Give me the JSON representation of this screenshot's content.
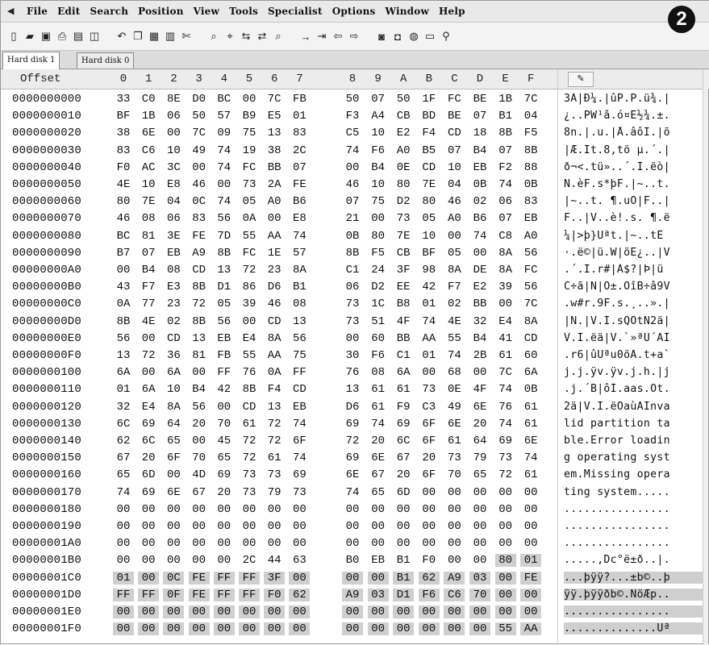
{
  "menu": {
    "items": [
      "File",
      "Edit",
      "Search",
      "Position",
      "View",
      "Tools",
      "Specialist",
      "Options",
      "Window",
      "Help"
    ],
    "app_icon": "back-arrow-icon"
  },
  "badge": {
    "label": "2"
  },
  "toolbar": {
    "buttons": [
      "new-file-icon",
      "open-folder-icon",
      "save-icon",
      "print-icon",
      "properties-icon",
      "open-disk-icon",
      "undo-icon",
      "copy-icon",
      "paste-block-icon",
      "paste-icon",
      "clipboard-icon",
      "find-icon",
      "find-hex-icon",
      "replace-icon",
      "replace-hex-icon",
      "find-next-icon",
      "goto-offset-icon",
      "goto-sector-icon",
      "back-icon",
      "forward-icon",
      "disk-icon",
      "disk-copy-icon",
      "disk-view-icon",
      "memory-icon",
      "zoom-icon"
    ]
  },
  "tabs": [
    {
      "label": "Hard disk 1",
      "active": true
    },
    {
      "label": "Hard disk 0",
      "active": false
    }
  ],
  "header": {
    "offset_label": "Offset",
    "columns": [
      "0",
      "1",
      "2",
      "3",
      "4",
      "5",
      "6",
      "7",
      "8",
      "9",
      "A",
      "B",
      "C",
      "D",
      "E",
      "F"
    ],
    "ascii_tool_icon": "pencil-icon"
  },
  "rows": [
    {
      "offset": "0000000000",
      "bytes": [
        "33",
        "C0",
        "8E",
        "D0",
        "BC",
        "00",
        "7C",
        "FB",
        "50",
        "07",
        "50",
        "1F",
        "FC",
        "BE",
        "1B",
        "7C"
      ],
      "ascii": "3À|Ð¼.|ûP.P.ü¾.|"
    },
    {
      "offset": "0000000010",
      "bytes": [
        "BF",
        "1B",
        "06",
        "50",
        "57",
        "B9",
        "E5",
        "01",
        "F3",
        "A4",
        "CB",
        "BD",
        "BE",
        "07",
        "B1",
        "04"
      ],
      "ascii": "¿..PW¹å.ó¤Ë½¾.±."
    },
    {
      "offset": "0000000020",
      "bytes": [
        "38",
        "6E",
        "00",
        "7C",
        "09",
        "75",
        "13",
        "83",
        "C5",
        "10",
        "E2",
        "F4",
        "CD",
        "18",
        "8B",
        "F5"
      ],
      "ascii": "8n.|.u.|Å.âôÍ.|õ"
    },
    {
      "offset": "0000000030",
      "bytes": [
        "83",
        "C6",
        "10",
        "49",
        "74",
        "19",
        "38",
        "2C",
        "74",
        "F6",
        "A0",
        "B5",
        "07",
        "B4",
        "07",
        "8B"
      ],
      "ascii": "|Æ.It.8,tö µ.´.|"
    },
    {
      "offset": "0000000040",
      "bytes": [
        "F0",
        "AC",
        "3C",
        "00",
        "74",
        "FC",
        "BB",
        "07",
        "00",
        "B4",
        "0E",
        "CD",
        "10",
        "EB",
        "F2",
        "88"
      ],
      "ascii": "ð¬<.tü»..´.Í.ëò|"
    },
    {
      "offset": "0000000050",
      "bytes": [
        "4E",
        "10",
        "E8",
        "46",
        "00",
        "73",
        "2A",
        "FE",
        "46",
        "10",
        "80",
        "7E",
        "04",
        "0B",
        "74",
        "0B"
      ],
      "ascii": "N.èF.s*þF.|~..t."
    },
    {
      "offset": "0000000060",
      "bytes": [
        "80",
        "7E",
        "04",
        "0C",
        "74",
        "05",
        "A0",
        "B6",
        "07",
        "75",
        "D2",
        "80",
        "46",
        "02",
        "06",
        "83"
      ],
      "ascii": "|~..t. ¶.uÒ|F..|"
    },
    {
      "offset": "0000000070",
      "bytes": [
        "46",
        "08",
        "06",
        "83",
        "56",
        "0A",
        "00",
        "E8",
        "21",
        "00",
        "73",
        "05",
        "A0",
        "B6",
        "07",
        "EB"
      ],
      "ascii": "F..|V..è!.s. ¶.ë"
    },
    {
      "offset": "0000000080",
      "bytes": [
        "BC",
        "81",
        "3E",
        "FE",
        "7D",
        "55",
        "AA",
        "74",
        "0B",
        "80",
        "7E",
        "10",
        "00",
        "74",
        "C8",
        "A0"
      ],
      "ascii": "¼|>þ}Uªt.|~..tÈ "
    },
    {
      "offset": "0000000090",
      "bytes": [
        "B7",
        "07",
        "EB",
        "A9",
        "8B",
        "FC",
        "1E",
        "57",
        "8B",
        "F5",
        "CB",
        "BF",
        "05",
        "00",
        "8A",
        "56"
      ],
      "ascii": "·.ë©|ü.W|õË¿..|V"
    },
    {
      "offset": "00000000A0",
      "bytes": [
        "00",
        "B4",
        "08",
        "CD",
        "13",
        "72",
        "23",
        "8A",
        "C1",
        "24",
        "3F",
        "98",
        "8A",
        "DE",
        "8A",
        "FC"
      ],
      "ascii": ".´.Í.r#|Á$?|Þ|ü"
    },
    {
      "offset": "00000000B0",
      "bytes": [
        "43",
        "F7",
        "E3",
        "8B",
        "D1",
        "86",
        "D6",
        "B1",
        "06",
        "D2",
        "EE",
        "42",
        "F7",
        "E2",
        "39",
        "56"
      ],
      "ascii": "C÷ã|Ñ|Ö±.ÒîB÷â9V"
    },
    {
      "offset": "00000000C0",
      "bytes": [
        "0A",
        "77",
        "23",
        "72",
        "05",
        "39",
        "46",
        "08",
        "73",
        "1C",
        "B8",
        "01",
        "02",
        "BB",
        "00",
        "7C"
      ],
      "ascii": ".w#r.9F.s.¸..».|"
    },
    {
      "offset": "00000000D0",
      "bytes": [
        "8B",
        "4E",
        "02",
        "8B",
        "56",
        "00",
        "CD",
        "13",
        "73",
        "51",
        "4F",
        "74",
        "4E",
        "32",
        "E4",
        "8A"
      ],
      "ascii": "|N.|V.Í.sQOtN2ä|"
    },
    {
      "offset": "00000000E0",
      "bytes": [
        "56",
        "00",
        "CD",
        "13",
        "EB",
        "E4",
        "8A",
        "56",
        "00",
        "60",
        "BB",
        "AA",
        "55",
        "B4",
        "41",
        "CD"
      ],
      "ascii": "V.Í.ëä|V.`»ªU´AÍ"
    },
    {
      "offset": "00000000F0",
      "bytes": [
        "13",
        "72",
        "36",
        "81",
        "FB",
        "55",
        "AA",
        "75",
        "30",
        "F6",
        "C1",
        "01",
        "74",
        "2B",
        "61",
        "60"
      ],
      "ascii": ".r6|ûUªu0öÁ.t+a`"
    },
    {
      "offset": "0000000100",
      "bytes": [
        "6A",
        "00",
        "6A",
        "00",
        "FF",
        "76",
        "0A",
        "FF",
        "76",
        "08",
        "6A",
        "00",
        "68",
        "00",
        "7C",
        "6A"
      ],
      "ascii": "j.j.ÿv.ÿv.j.h.|j"
    },
    {
      "offset": "0000000110",
      "bytes": [
        "01",
        "6A",
        "10",
        "B4",
        "42",
        "8B",
        "F4",
        "CD",
        "13",
        "61",
        "61",
        "73",
        "0E",
        "4F",
        "74",
        "0B"
      ],
      "ascii": ".j.´B|ôÍ.aas.Ot."
    },
    {
      "offset": "0000000120",
      "bytes": [
        "32",
        "E4",
        "8A",
        "56",
        "00",
        "CD",
        "13",
        "EB",
        "D6",
        "61",
        "F9",
        "C3",
        "49",
        "6E",
        "76",
        "61"
      ],
      "ascii": "2ä|V.Í.ëÖaùÃInva"
    },
    {
      "offset": "0000000130",
      "bytes": [
        "6C",
        "69",
        "64",
        "20",
        "70",
        "61",
        "72",
        "74",
        "69",
        "74",
        "69",
        "6F",
        "6E",
        "20",
        "74",
        "61"
      ],
      "ascii": "lid partition ta"
    },
    {
      "offset": "0000000140",
      "bytes": [
        "62",
        "6C",
        "65",
        "00",
        "45",
        "72",
        "72",
        "6F",
        "72",
        "20",
        "6C",
        "6F",
        "61",
        "64",
        "69",
        "6E"
      ],
      "ascii": "ble.Error loadin"
    },
    {
      "offset": "0000000150",
      "bytes": [
        "67",
        "20",
        "6F",
        "70",
        "65",
        "72",
        "61",
        "74",
        "69",
        "6E",
        "67",
        "20",
        "73",
        "79",
        "73",
        "74"
      ],
      "ascii": "g operating syst"
    },
    {
      "offset": "0000000160",
      "bytes": [
        "65",
        "6D",
        "00",
        "4D",
        "69",
        "73",
        "73",
        "69",
        "6E",
        "67",
        "20",
        "6F",
        "70",
        "65",
        "72",
        "61"
      ],
      "ascii": "em.Missing opera"
    },
    {
      "offset": "0000000170",
      "bytes": [
        "74",
        "69",
        "6E",
        "67",
        "20",
        "73",
        "79",
        "73",
        "74",
        "65",
        "6D",
        "00",
        "00",
        "00",
        "00",
        "00"
      ],
      "ascii": "ting system....."
    },
    {
      "offset": "0000000180",
      "bytes": [
        "00",
        "00",
        "00",
        "00",
        "00",
        "00",
        "00",
        "00",
        "00",
        "00",
        "00",
        "00",
        "00",
        "00",
        "00",
        "00"
      ],
      "ascii": "................"
    },
    {
      "offset": "0000000190",
      "bytes": [
        "00",
        "00",
        "00",
        "00",
        "00",
        "00",
        "00",
        "00",
        "00",
        "00",
        "00",
        "00",
        "00",
        "00",
        "00",
        "00"
      ],
      "ascii": "................"
    },
    {
      "offset": "00000001A0",
      "bytes": [
        "00",
        "00",
        "00",
        "00",
        "00",
        "00",
        "00",
        "00",
        "00",
        "00",
        "00",
        "00",
        "00",
        "00",
        "00",
        "00"
      ],
      "ascii": "................"
    },
    {
      "offset": "00000001B0",
      "bytes": [
        "00",
        "00",
        "00",
        "00",
        "00",
        "2C",
        "44",
        "63",
        "B0",
        "EB",
        "B1",
        "F0",
        "00",
        "00",
        "80",
        "01"
      ],
      "ascii": ".....,Dc°ë±ð..|."
    },
    {
      "offset": "00000001C0",
      "bytes": [
        "01",
        "00",
        "0C",
        "FE",
        "FF",
        "FF",
        "3F",
        "00",
        "00",
        "00",
        "B1",
        "62",
        "A9",
        "03",
        "00",
        "FE"
      ],
      "ascii": "...þÿÿ?...±b©..þ"
    },
    {
      "offset": "00000001D0",
      "bytes": [
        "FF",
        "FF",
        "0F",
        "FE",
        "FF",
        "FF",
        "F0",
        "62",
        "A9",
        "03",
        "D1",
        "F6",
        "C6",
        "70",
        "00",
        "00"
      ],
      "ascii": "ÿÿ.þÿÿðb©.ÑöÆp.."
    },
    {
      "offset": "00000001E0",
      "bytes": [
        "00",
        "00",
        "00",
        "00",
        "00",
        "00",
        "00",
        "00",
        "00",
        "00",
        "00",
        "00",
        "00",
        "00",
        "00",
        "00"
      ],
      "ascii": "................"
    },
    {
      "offset": "00000001F0",
      "bytes": [
        "00",
        "00",
        "00",
        "00",
        "00",
        "00",
        "00",
        "00",
        "00",
        "00",
        "00",
        "00",
        "00",
        "00",
        "55",
        "AA"
      ],
      "ascii": "..............Uª"
    }
  ],
  "selection": {
    "start_row": "00000001B0",
    "start_col": "E",
    "end_row": "00000001F0",
    "end_col": "F"
  }
}
